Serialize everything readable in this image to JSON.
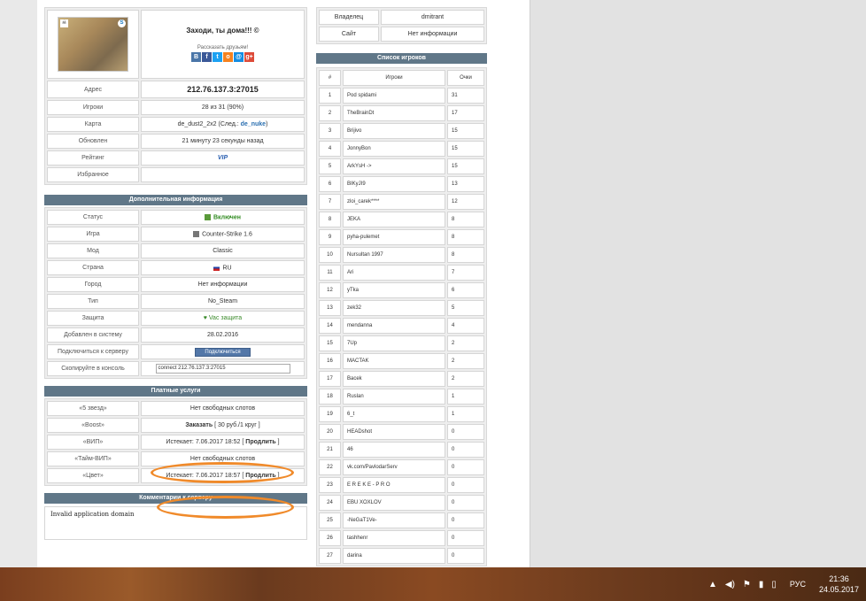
{
  "server": {
    "welcome": "Заходи, ты дома!!! ©",
    "share_label": "Рассказать друзьям!",
    "social": [
      "В",
      "f",
      "t",
      "о",
      "@",
      "g+"
    ],
    "rows": [
      {
        "key": "Адрес",
        "value": "212.76.137.3:27015"
      },
      {
        "key": "Игроки",
        "value": "28 из 31 (90%)"
      },
      {
        "key": "Карта",
        "value": "de_dust2_2x2",
        "next_prefix": "(След.:",
        "next_map": "de_nuke",
        "next_suffix": ")"
      },
      {
        "key": "Обновлен",
        "value": "21 минуту 23 секунды назад"
      },
      {
        "key": "Рейтинг",
        "value": "VIP"
      },
      {
        "key": "Избранное",
        "value": ""
      }
    ]
  },
  "additional": {
    "title": "Дополнительная информация",
    "status_key": "Статус",
    "status_value": "Включен",
    "game_key": "Игра",
    "game_value": "Counter-Strike 1.6",
    "mod_key": "Мод",
    "mod_value": "Classic",
    "country_key": "Страна",
    "country_value": "RU",
    "city_key": "Город",
    "city_value": "Нет информации",
    "type_key": "Тип",
    "type_value": "No_Steam",
    "protect_key": "Защита",
    "protect_value": "Vac защита",
    "added_key": "Добавлен в систему",
    "added_value": "28.02.2016",
    "connect_key": "Подключиться к серверу",
    "connect_button": "Подключиться",
    "console_key": "Скопируйте в консоль",
    "console_value": "connect 212.76.137.3:27015"
  },
  "paid": {
    "title": "Платные услуги",
    "star_key": "«5 звезд»",
    "star_value": "Нет свободных слотов",
    "boost_key": "«Boost»",
    "boost_order": "Заказать",
    "boost_price": "[ 30 руб./1 круг ]",
    "vip_key": "«ВИП»",
    "vip_expires": "Истекает: 7.06.2017 18:52",
    "vip_extend": "Продлить",
    "tvip_key": "«Тайм-ВИП»",
    "tvip_value": "Нет свободных слотов",
    "color_key": "«Цвет»",
    "color_expires": "Истекает: 7.06.2017 18:57",
    "color_extend": "Продлить"
  },
  "comments": {
    "title": "Комментарии к серверу",
    "text": "Invalid application domain"
  },
  "owner": {
    "owner_key": "Владелец",
    "owner_value": "dmitrant",
    "site_key": "Сайт",
    "site_value": "Нет информации"
  },
  "players": {
    "title": "Список игроков",
    "col_num": "#",
    "col_name": "Игроки",
    "col_score": "Очки",
    "list": [
      {
        "n": "1",
        "name": "Pod spidami",
        "score": "31"
      },
      {
        "n": "2",
        "name": "TheBrainDt",
        "score": "17"
      },
      {
        "n": "3",
        "name": "Brijivo",
        "score": "15"
      },
      {
        "n": "4",
        "name": "JonnyBon",
        "score": "15"
      },
      {
        "n": "5",
        "name": "ArkYsH ->",
        "score": "15"
      },
      {
        "n": "6",
        "name": "BIKyJI9",
        "score": "13"
      },
      {
        "n": "7",
        "name": "zloi_carek****",
        "score": "12"
      },
      {
        "n": "8",
        "name": "JEKA",
        "score": "8"
      },
      {
        "n": "9",
        "name": "pyha-pulemet",
        "score": "8"
      },
      {
        "n": "10",
        "name": "Nursultan 1997",
        "score": "8"
      },
      {
        "n": "11",
        "name": "Ari",
        "score": "7"
      },
      {
        "n": "12",
        "name": "yTka",
        "score": "6"
      },
      {
        "n": "13",
        "name": "zek32",
        "score": "5"
      },
      {
        "n": "14",
        "name": "mendanna",
        "score": "4"
      },
      {
        "n": "15",
        "name": "7Up",
        "score": "2"
      },
      {
        "n": "16",
        "name": "MACTAK",
        "score": "2"
      },
      {
        "n": "17",
        "name": "Bacek",
        "score": "2"
      },
      {
        "n": "18",
        "name": "Ruslan",
        "score": "1"
      },
      {
        "n": "19",
        "name": "6_t",
        "score": "1"
      },
      {
        "n": "20",
        "name": "HEADshot",
        "score": "0"
      },
      {
        "n": "21",
        "name": "46",
        "score": "0"
      },
      {
        "n": "22",
        "name": "vk.com/PavlodarServ",
        "score": "0"
      },
      {
        "n": "23",
        "name": "E R E K E - P R O",
        "score": "0"
      },
      {
        "n": "24",
        "name": "EBU XOXLOV",
        "score": "0"
      },
      {
        "n": "25",
        "name": "-NeGaT1Ve-",
        "score": "0"
      },
      {
        "n": "26",
        "name": "tashhenr",
        "score": "0"
      },
      {
        "n": "27",
        "name": "darina",
        "score": "0"
      }
    ]
  },
  "taskbar": {
    "lang": "РУС",
    "time": "21:36",
    "date": "24.05.2017"
  }
}
